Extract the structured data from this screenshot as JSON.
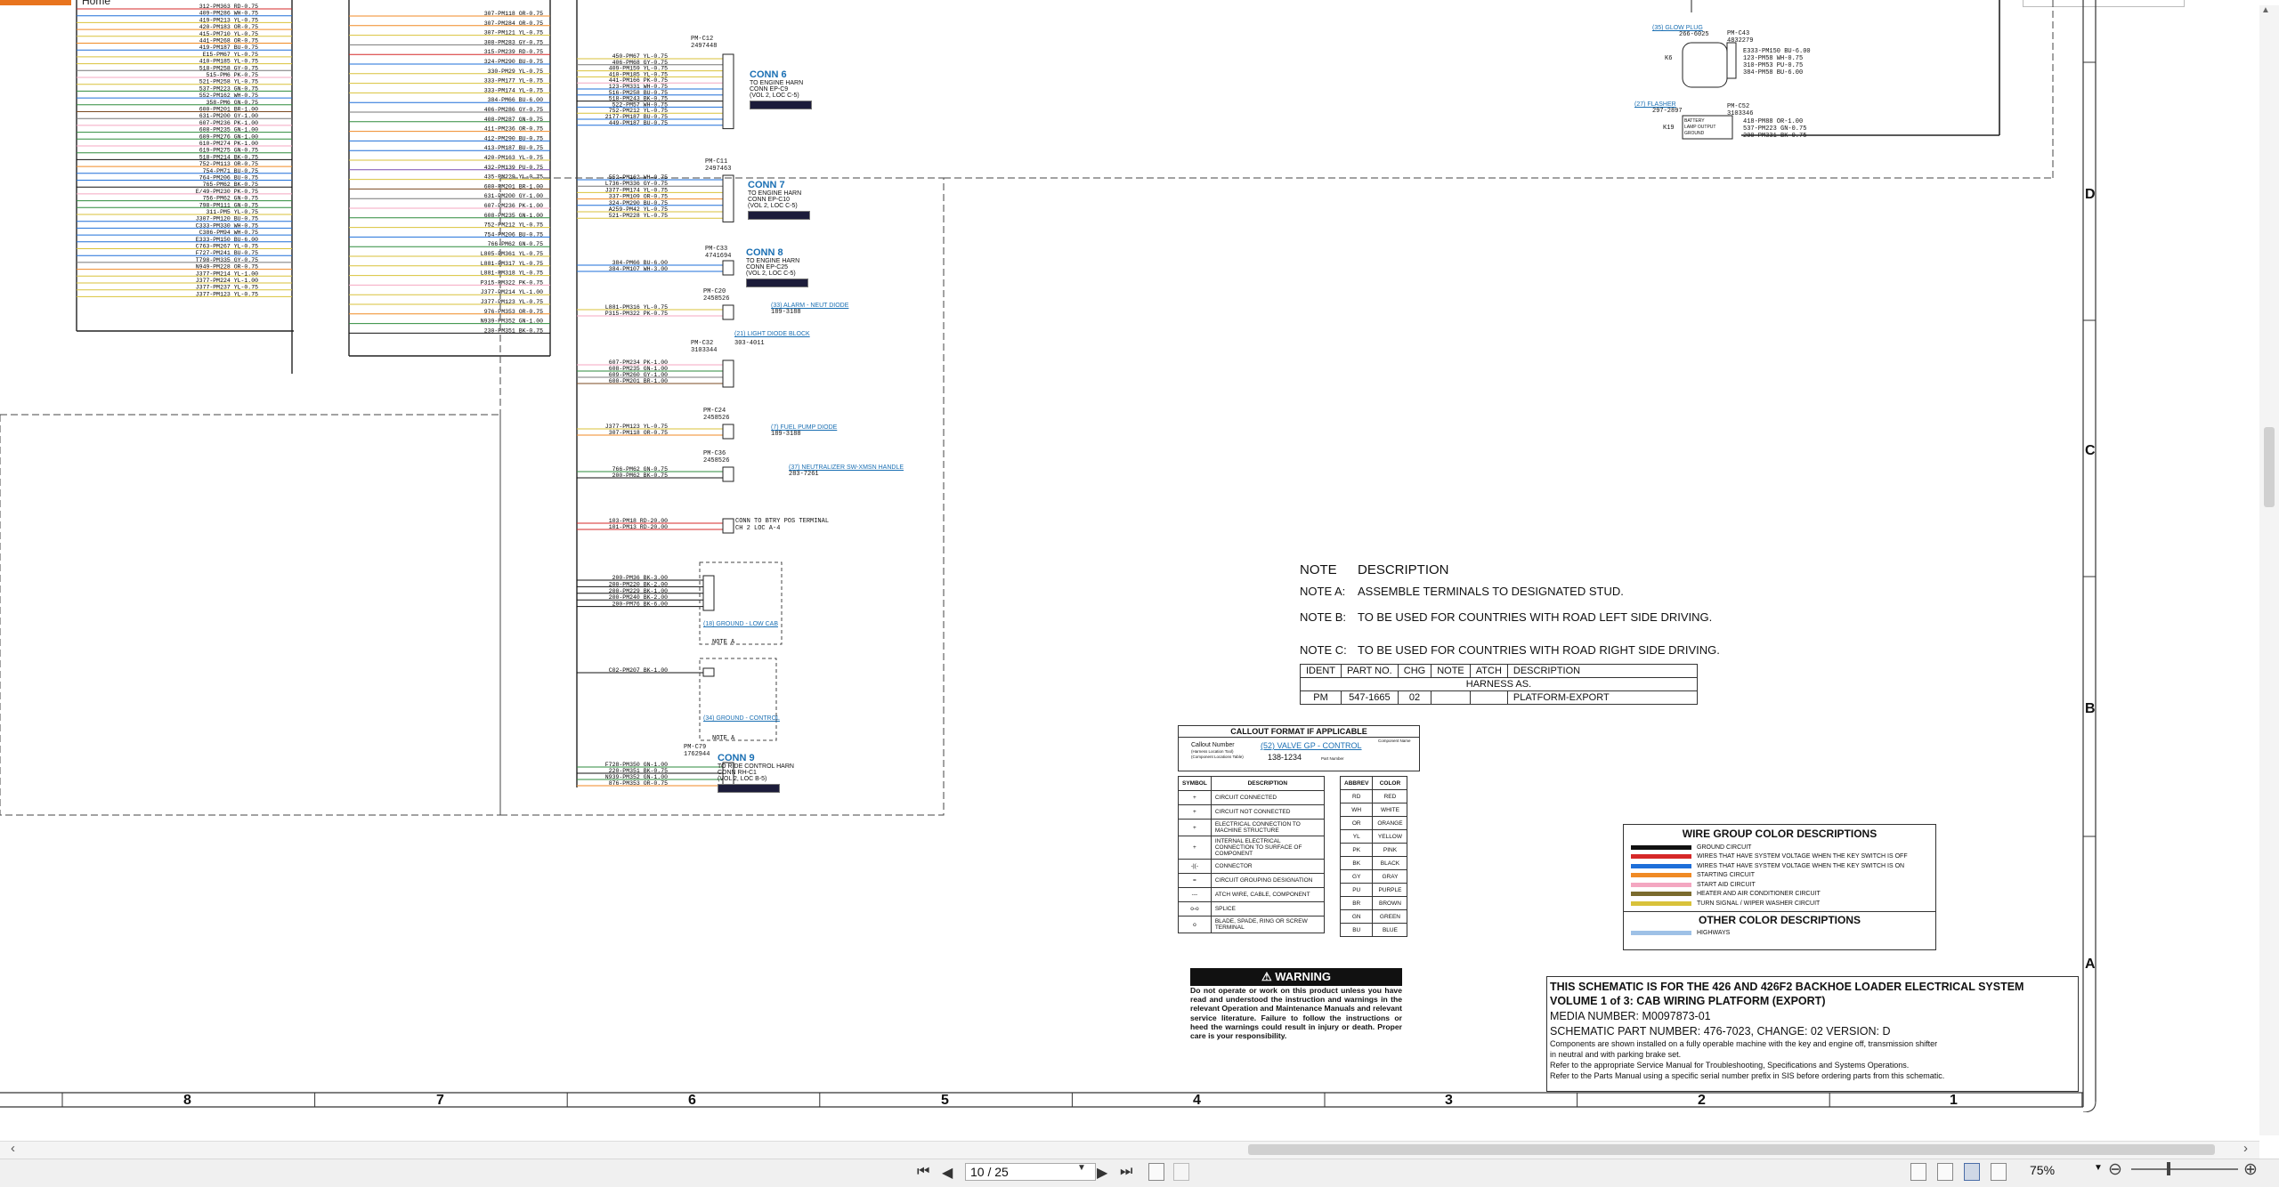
{
  "app": {
    "home_label": "Home"
  },
  "schematic": {
    "left_wires_a": [
      "312-PM363 RD-0.75",
      "409-PM286 WH-0.75",
      "419-PM213 YL-0.75",
      "420-PM183 OR-0.75",
      "415-PM710 YL-0.75",
      "441-PM268 OR-0.75",
      "419-PM187 BU-0.75",
      "E15-PM67 YL-0.75",
      "410-PM185 YL-0.75",
      "518-PM258 GY-0.75",
      "515-PM6 PK-0.75",
      "521-PM258 YL-0.75",
      "537-PM223 GN-0.75",
      "552-PM162 WH-0.75",
      "358-PM6 GN-0.75",
      "600-PM201 BR-1.00",
      "631-PM200 GY-1.00",
      "607-PM236 PK-1.00",
      "608-PM235 GN-1.00",
      "609-PM276 GN-1.00",
      "610-PM274 PK-1.00",
      "619-PM275 GN-0.75",
      "518-PM214 BK-0.75",
      "752-PM113 OR-0.75",
      "754-PM71 BU-0.75",
      "764-PM206 BU-0.75",
      "765-PM62 BK-0.75",
      "E/49-PM230 PK-0.75",
      "756-PM62 GN-0.75",
      "798-PM111 GN-0.75",
      "311-PM5 YL-0.75",
      "J307-PM120 BU-0.75",
      "C333-PM330 WH-0.75",
      "C386-PM94 WH-0.75",
      "E333-PM150 BU-6.00",
      "C763-PM267 YL-0.75",
      "F727-PM241 BU-0.75",
      "T798-PM335 GY-0.75",
      "N949-PM228 OR-0.75",
      "J377-PM214 YL-1.00",
      "J377-PM224 YL-1.00",
      "J377-PM237 YL-0.75",
      "J377-PM123 YL-0.75"
    ],
    "left_wires_b": [
      "307-PM118 OR-0.75",
      "307-PM284 OR-0.75",
      "307-PM121 YL-0.75",
      "308-PM283 GY-0.75",
      "315-PM239 RD-0.75",
      "324-PM290 BU-0.75",
      "330-PM29 YL-0.75",
      "333-PM177 YL-0.75",
      "333-PM174 YL-0.75",
      "384-PM66 BU-6.00",
      "406-PM286 GY-0.75",
      "408-PM287 GN-0.75",
      "411-PM236 OR-0.75",
      "412-PM290 BU-0.75",
      "413-PM187 BU-0.75",
      "420-PM163 YL-0.75",
      "432-PM139 PU-0.75",
      "435-PM229 YL-0.75",
      "600-PM201 BR-1.00",
      "631-PM200 GY-1.00",
      "607-PM236 PK-1.00",
      "608-PM235 GN-1.00",
      "752-PM212 YL-0.75",
      "754-PM206 BU-0.75",
      "766-PM62 GN-0.75",
      "L805-PM361 YL-0.75",
      "L881-PM317 YL-0.75",
      "L881-PM318 YL-0.75",
      "P315-PM322 PK-0.75",
      "J377-PM214 YL-1.00",
      "J377-PM123 YL-0.75",
      "976-PM353 OR-0.75",
      "N939-PM352 GN-1.00",
      "230-PM351 BK-0.75"
    ],
    "conn6": {
      "id": "PM-C12",
      "part": "2497448",
      "title": "CONN 6",
      "sub": [
        "TO ENGINE HARN",
        "CONN EP-C9",
        "(VOL 2, LOC C-5)"
      ]
    },
    "conn7": {
      "id": "PM-C11",
      "part": "2497463",
      "title": "CONN 7",
      "sub": [
        "TO ENGINE HARN",
        "CONN EP-C10",
        "(VOL 2, LOC C-5)"
      ]
    },
    "conn8": {
      "id": "PM-C33",
      "part": "4741694",
      "title": "CONN 8",
      "sub": [
        "TO ENGINE HARN",
        "CONN EP-C25",
        "(VOL 2, LOC C-5)"
      ]
    },
    "conn9": {
      "id": "PM-C79",
      "part": "1762944",
      "title": "CONN 9",
      "sub": [
        "TO RIDE CONTROL HARN",
        "CONN RH-C1",
        "(VOL 2, LOC B-5)"
      ]
    },
    "conn6_wires": [
      "450-PM67 YL-0.75",
      "406-PM68 GY-0.75",
      "409-PM159 YL-0.75",
      "410-PM185 YL-0.75",
      "441-PM166 PK-0.75",
      "123-PM331 WH-0.75",
      "516-PM258 BU-0.75",
      "518-PM243 BK-0.75",
      "522-PM57 WH-0.75",
      "752-PM212 YL-0.75",
      "2177-PM187 BU-0.75",
      "449-PM187 BU-0.75"
    ],
    "conn7_wires": [
      "552-PM162 WH-0.75",
      "L736-PM336 GY-0.75",
      "J377-PM174 YL-0.75",
      "337-PM109 OR-0.75",
      "324-PM290 BU-0.75",
      "A259-PM42 YL-0.75",
      "521-PM228 YL-0.75"
    ],
    "conn8_wires": [
      "384-PM66 BU-6.00",
      "384-PM107 WH-3.00"
    ],
    "c20": {
      "id": "PM-C20",
      "part": "2458526",
      "link": "(33) ALARM - NEUT DIODE",
      "pn": "189-3188",
      "wires": [
        "L881-PM316 YL-0.75",
        "P315-PM322 PK-0.75"
      ]
    },
    "c32": {
      "id": "PM-C32",
      "part": "3103344",
      "link": "(21) LIGHT DIODE BLOCK",
      "pn": "303-4011",
      "wires": [
        "607-PM234 PK-1.00",
        "608-PM235 GN-1.00",
        "609-PM260 GY-1.00",
        "600-PM201 BR-1.00"
      ]
    },
    "c24": {
      "id": "PM-C24",
      "part": "2458526",
      "link": "(7) FUEL PUMP DIODE",
      "pn": "189-3188",
      "wires": [
        "J377-PM123 YL-0.75",
        "307-PM118 OR-0.75"
      ]
    },
    "c36": {
      "id": "PM-C36",
      "part": "2458526",
      "link": "(37) NEUTRALIZER SW-XMSN HANDLE",
      "pn": "283-7261",
      "wires": [
        "766-PM62 GN-0.75",
        "200-PM62 BK-0.75"
      ]
    },
    "batt": {
      "wires": [
        "103-PM18 RD-20.00",
        "101-PM13 RD-20.00"
      ],
      "note": [
        "CONN TO BTRY POS TERMINAL",
        "CH 2 LOC A-4"
      ]
    },
    "gnd_cab": {
      "wires": [
        "200-PM36 BK-3.00",
        "200-PM220 BK-2.00",
        "200-PM229 BK-1.00",
        "200-PM240 BK-2.00",
        "200-PM76 BK-6.00"
      ],
      "link": "(18) GROUND - LOW CAB",
      "note": "NOTE A"
    },
    "gnd_ctrl": {
      "wires": [
        "C02-PM207 BK-1.00"
      ],
      "link": "(34) GROUND - CONTROL",
      "note": "NOTE A"
    },
    "conn9_wires": [
      "F728-PM350 GN-1.00",
      "220-PM351 BK-0.75",
      "N939-PM352 GN-1.00",
      "876-PM353 OR-0.75"
    ],
    "right_top": {
      "glow_link": "(35) GLOW PLUG",
      "glow_pn": "266-6025",
      "glow_id": "PM-C43",
      "glow_part": "4832279",
      "glow_k": "K6",
      "glow_wires": [
        "E333-PM150 BU-6.00",
        "123-PM58 WH-0.75",
        "310-PM53 PU-0.75",
        "384-PM58 BU-6.00"
      ],
      "flasher_link": "(27) FLASHER",
      "flasher_pn": "297-2897",
      "flasher_id": "PM-C52",
      "flasher_part": "3103346",
      "flasher_k": "K19",
      "flasher_pins": [
        "BATTERY",
        "LAMP OUTPUT",
        "GROUND"
      ],
      "flasher_wires": [
        "418-PM88 OR-1.00",
        "537-PM223 GN-0.75",
        "200-PM331 BK-0.75"
      ]
    }
  },
  "notes": {
    "header_code": "NOTE",
    "header_desc": "DESCRIPTION",
    "rows": [
      {
        "code": "NOTE A:",
        "desc": "ASSEMBLE TERMINALS TO DESIGNATED STUD."
      },
      {
        "code": "NOTE B:",
        "desc": "TO BE USED FOR COUNTRIES WITH ROAD LEFT SIDE DRIVING."
      },
      {
        "code": "NOTE C:",
        "desc": "TO BE USED FOR COUNTRIES WITH ROAD RIGHT SIDE DRIVING."
      }
    ]
  },
  "ident": {
    "headers": [
      "IDENT",
      "PART NO.",
      "CHG",
      "NOTE",
      "ATCH",
      "DESCRIPTION"
    ],
    "harness": "HARNESS AS.",
    "row": [
      "PM",
      "547-1665",
      "02",
      "",
      "",
      "PLATFORM-EXPORT"
    ]
  },
  "callout_format": {
    "title": "CALLOUT FORMAT IF APPLICABLE",
    "line1": "Callout Number",
    "line1b": "(Harness Location Tool)",
    "line1c": "(Component Locations Table)",
    "example": "(52) VALVE GP - CONTROL",
    "example_pn": "138-1234",
    "pn_label": "Part Number",
    "name_label": "Component Name"
  },
  "symbols": {
    "headers": [
      "SYMBOL",
      "DESCRIPTION"
    ],
    "rows": [
      {
        "sym": "+",
        "desc": "CIRCUIT CONNECTED"
      },
      {
        "sym": "+",
        "desc": "CIRCUIT NOT CONNECTED"
      },
      {
        "sym": "+",
        "desc": "ELECTRICAL CONNECTION TO MACHINE STRUCTURE"
      },
      {
        "sym": "+",
        "desc": "INTERNAL ELECTRICAL CONNECTION TO SURFACE OF COMPONENT"
      },
      {
        "sym": "-|(-",
        "desc": "CONNECTOR"
      },
      {
        "sym": "=",
        "desc": "CIRCUIT GROUPING DESIGNATION"
      },
      {
        "sym": "---",
        "desc": "ATCH WIRE, CABLE, COMPONENT"
      },
      {
        "sym": "o-o",
        "desc": "SPLICE"
      },
      {
        "sym": "o",
        "desc": "BLADE, SPADE, RING OR SCREW TERMINAL"
      }
    ]
  },
  "abbrev": {
    "headers": [
      "ABBREV",
      "COLOR"
    ],
    "rows": [
      [
        "RD",
        "RED"
      ],
      [
        "WH",
        "WHITE"
      ],
      [
        "OR",
        "ORANGE"
      ],
      [
        "YL",
        "YELLOW"
      ],
      [
        "PK",
        "PINK"
      ],
      [
        "BK",
        "BLACK"
      ],
      [
        "GY",
        "GRAY"
      ],
      [
        "PU",
        "PURPLE"
      ],
      [
        "BR",
        "BROWN"
      ],
      [
        "GN",
        "GREEN"
      ],
      [
        "BU",
        "BLUE"
      ]
    ]
  },
  "warning": {
    "title": "WARNING",
    "text": "Do not operate or work on this product unless you have read and understood the instruction and warnings in the relevant Operation and Maintenance Manuals and relevant service literature. Failure to follow the instructions or heed the warnings could result in injury or death. Proper care is your responsibility."
  },
  "wire_groups": {
    "title": "WIRE GROUP COLOR DESCRIPTIONS",
    "rows": [
      {
        "color": "#111111",
        "desc": "GROUND CIRCUIT"
      },
      {
        "color": "#d62828",
        "desc": "WIRES THAT HAVE SYSTEM VOLTAGE WHEN THE KEY SWITCH IS OFF"
      },
      {
        "color": "#1e6fd9",
        "desc": "WIRES THAT HAVE SYSTEM VOLTAGE WHEN THE KEY SWITCH IS ON"
      },
      {
        "color": "#f08a24",
        "desc": "STARTING CIRCUIT"
      },
      {
        "color": "#f4a7c1",
        "desc": "START AID CIRCUIT"
      },
      {
        "color": "#7b6b2e",
        "desc": "HEATER AND AIR CONDITIONER CIRCUIT"
      },
      {
        "color": "#d9c23a",
        "desc": "TURN SIGNAL / WIPER WASHER CIRCUIT"
      }
    ],
    "other_title": "OTHER COLOR DESCRIPTIONS",
    "other_rows": [
      {
        "color": "#9ec1e6",
        "desc": "HIGHWAYS"
      }
    ]
  },
  "title_block": {
    "line1": "THIS SCHEMATIC IS FOR THE 426 AND 426F2 BACKHOE LOADER ELECTRICAL SYSTEM",
    "line2": "VOLUME 1 of 3: CAB WIRING PLATFORM (EXPORT)",
    "line3": "MEDIA NUMBER: M0097873-01",
    "line4": "SCHEMATIC PART NUMBER: 476-7023, CHANGE: 02 VERSION: D",
    "note1": "Components are shown installed on a fully operable machine with the key and engine off, transmission shifter",
    "note2": "in neutral and with parking brake set.",
    "note3": "Refer to the appropriate Service Manual for Troubleshooting, Specifications and Systems Operations.",
    "note4": "Refer to the Parts Manual using a specific serial number prefix in SIS before ordering parts from this schematic."
  },
  "zones": {
    "letters": [
      "D",
      "C",
      "B",
      "A"
    ],
    "numbers": [
      "8",
      "7",
      "6",
      "5",
      "4",
      "3",
      "2",
      "1"
    ]
  },
  "viewer": {
    "page_value": "10 / 25",
    "zoom": "75%",
    "icons": {
      "first": "first-page-icon",
      "prev": "prev-page-icon",
      "next": "next-page-icon",
      "last": "last-page-icon"
    }
  },
  "colors": {
    "accent": "#e8741e",
    "link": "#1a6fb3"
  }
}
